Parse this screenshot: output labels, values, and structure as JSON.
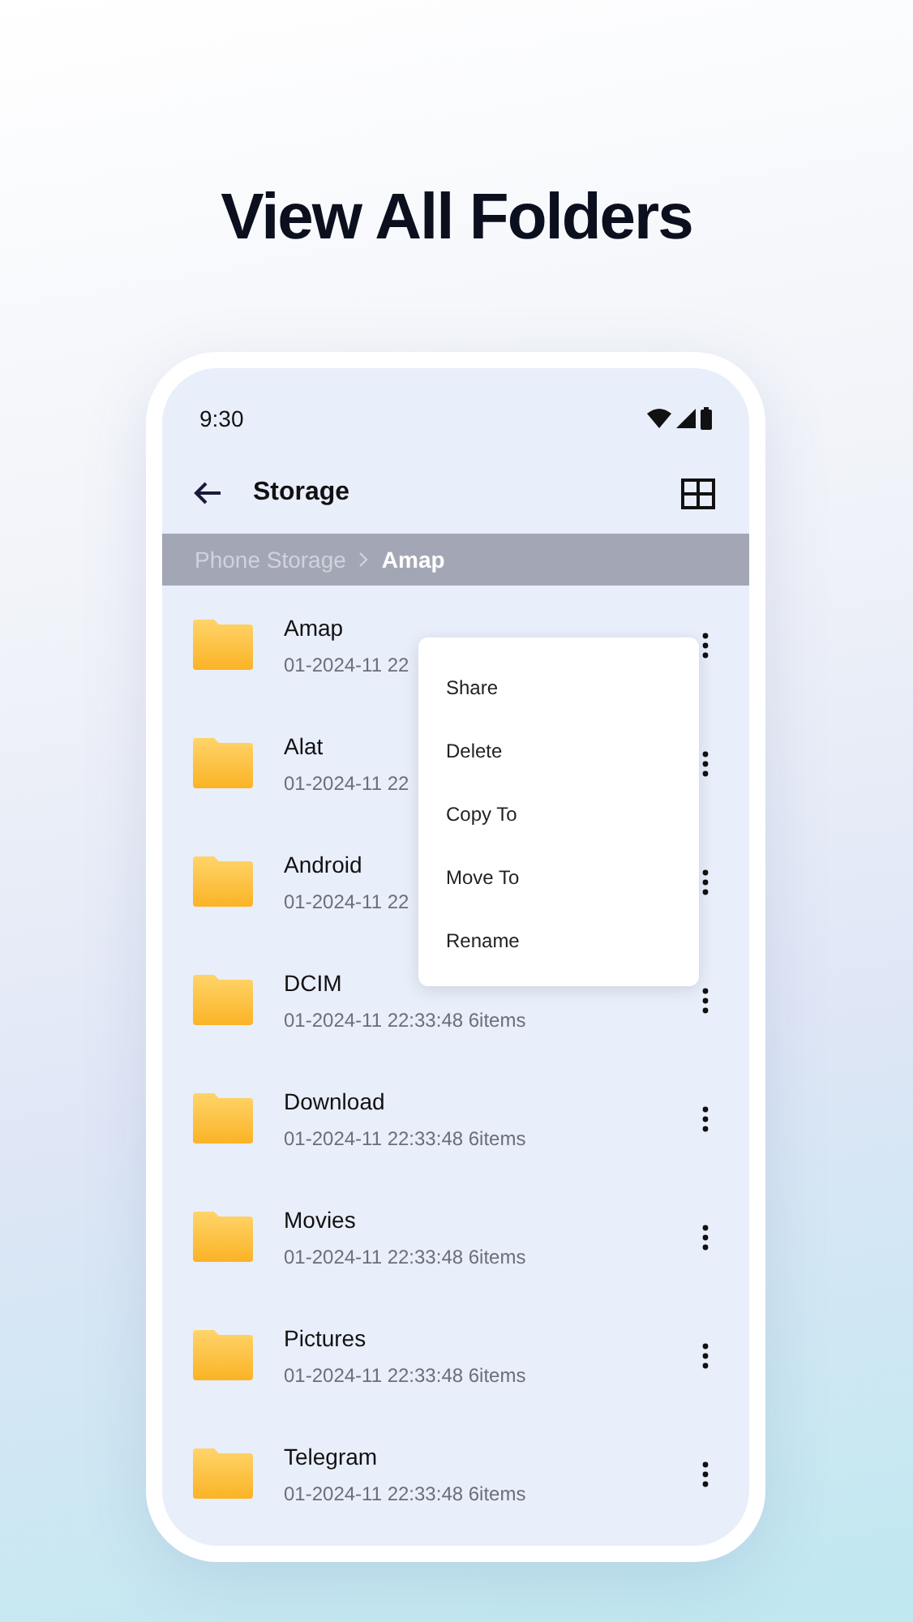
{
  "headline": "View All Folders",
  "status_bar": {
    "time": "9:30"
  },
  "toolbar": {
    "title": "Storage"
  },
  "breadcrumb": [
    {
      "label": "Phone Storage",
      "selected": false
    },
    {
      "label": "Amap",
      "selected": true
    }
  ],
  "folders": [
    {
      "name": "Amap",
      "details": "01-2024-11 22"
    },
    {
      "name": "Alat",
      "details": "01-2024-11 22"
    },
    {
      "name": "Android",
      "details": "01-2024-11 22"
    },
    {
      "name": "DCIM",
      "details": "01-2024-11 22:33:48 6items"
    },
    {
      "name": "Download",
      "details": "01-2024-11 22:33:48 6items"
    },
    {
      "name": "Movies",
      "details": "01-2024-11 22:33:48 6items"
    },
    {
      "name": "Pictures",
      "details": "01-2024-11 22:33:48 6items"
    },
    {
      "name": "Telegram",
      "details": "01-2024-11 22:33:48 6items"
    }
  ],
  "context_menu": [
    "Share",
    "Delete",
    "Copy To",
    "Move To",
    "Rename"
  ]
}
